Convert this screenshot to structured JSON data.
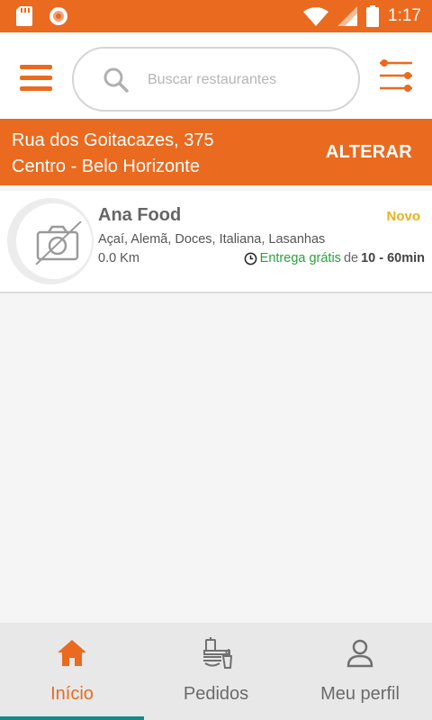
{
  "status_bar": {
    "time": "1:17",
    "icons": [
      "sd-card-icon",
      "record-icon",
      "wifi-icon",
      "signal-icon",
      "battery-icon"
    ]
  },
  "header": {
    "menu_icon": "hamburger-menu-icon",
    "search": {
      "placeholder": "Buscar restaurantes",
      "value": ""
    },
    "filter_icon": "filter-sliders-icon"
  },
  "address": {
    "line1": "Rua dos Goitacazes, 375",
    "line2": "Centro - Belo Horizonte",
    "change_label": "ALTERAR"
  },
  "restaurants": [
    {
      "name": "Ana Food",
      "badge": "Novo",
      "categories": "Açaí, Alemã, Doces, Italiana, Lasanhas",
      "distance": "0.0 Km",
      "delivery_label": "Entrega grátis",
      "delivery_connector": "de",
      "delivery_time": "10 - 60min",
      "image_icon": "no-photo-camera-icon"
    }
  ],
  "bottom_nav": {
    "items": [
      {
        "label": "Início",
        "icon": "home-icon",
        "active": true
      },
      {
        "label": "Pedidos",
        "icon": "food-combo-icon",
        "active": false
      },
      {
        "label": "Meu perfil",
        "icon": "user-icon",
        "active": false
      }
    ]
  },
  "colors": {
    "primary": "#ea6a1f",
    "badge": "#e8b21c",
    "free_delivery": "#27a33a",
    "nav_indicator": "#138a8a"
  }
}
